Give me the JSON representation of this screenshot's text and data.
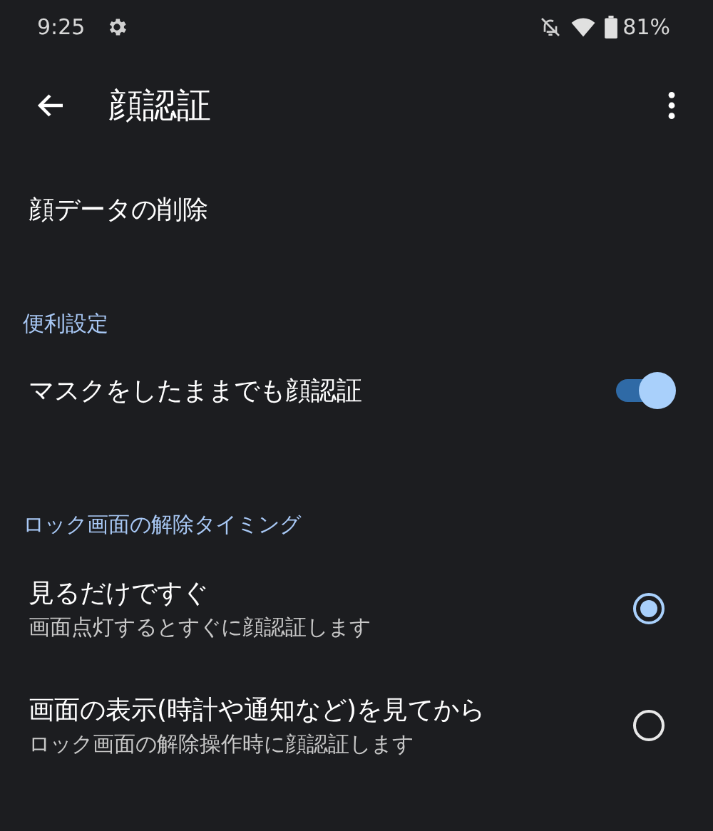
{
  "status_bar": {
    "time": "9:25",
    "battery_text": "81%"
  },
  "app_bar": {
    "title": "顔認証"
  },
  "items": [
    {
      "kind": "action",
      "title": "顔データの削除"
    },
    {
      "kind": "header",
      "title": "便利設定"
    },
    {
      "kind": "switch",
      "title": "マスクをしたままでも顔認証",
      "on": true
    },
    {
      "kind": "header",
      "title": "ロック画面の解除タイミング"
    },
    {
      "kind": "radio",
      "title": "見るだけですぐ",
      "summary": "画面点灯するとすぐに顔認証します",
      "selected": true
    },
    {
      "kind": "radio",
      "title": "画面の表示(時計や通知など)を見てから",
      "summary": "ロック画面の解除操作時に顔認証します",
      "selected": false
    }
  ]
}
